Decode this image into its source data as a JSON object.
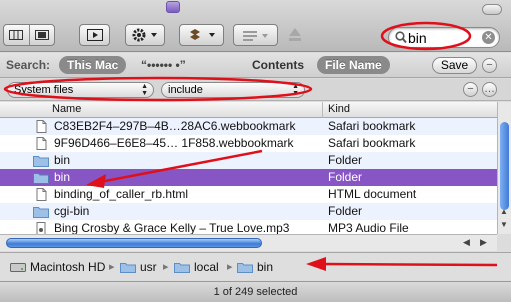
{
  "toolbar": {
    "search_query": "bin",
    "icons": [
      "icon-view-button",
      "column-view-button",
      "quicklook-button",
      "action-menu-button",
      "dropbox-button",
      "arrange-button",
      "eject-icon"
    ]
  },
  "scope_bar": {
    "search_label": "Search:",
    "this_mac": "This Mac",
    "shared_location": "“•••••• •”",
    "contents": "Contents",
    "file_name": "File Name",
    "save": "Save",
    "remove_symbol": "−",
    "add_symbol": "+"
  },
  "criteria": {
    "attribute": "System files",
    "operator": "include",
    "remove_symbol": "−",
    "add_symbol": "…"
  },
  "columns": {
    "name": "Name",
    "kind": "Kind"
  },
  "files": [
    {
      "name": "C83EB2F4–297B–4B…28AC6.webbookmark",
      "kind": "Safari bookmark",
      "icon": "document-icon"
    },
    {
      "name": "9F96D466–E6E8–45… 1F858.webbookmark",
      "kind": "Safari bookmark",
      "icon": "document-icon"
    },
    {
      "name": "bin",
      "kind": "Folder",
      "icon": "folder-icon"
    },
    {
      "name": "bin",
      "kind": "Folder",
      "icon": "folder-icon",
      "selected": true
    },
    {
      "name": "binding_of_caller_rb.html",
      "kind": "HTML document",
      "icon": "document-icon"
    },
    {
      "name": "cgi-bin",
      "kind": "Folder",
      "icon": "folder-icon"
    },
    {
      "name": "Bing Crosby & Grace Kelly – True Love.mp3",
      "kind": "MP3 Audio File",
      "icon": "audio-icon"
    }
  ],
  "path": [
    "Macintosh HD",
    "usr",
    "local",
    "bin"
  ],
  "status": "1 of 249 selected",
  "colors": {
    "selection": "#8855c4",
    "annotation": "#e0101a",
    "scroll_thumb": "#3e7cd8"
  }
}
